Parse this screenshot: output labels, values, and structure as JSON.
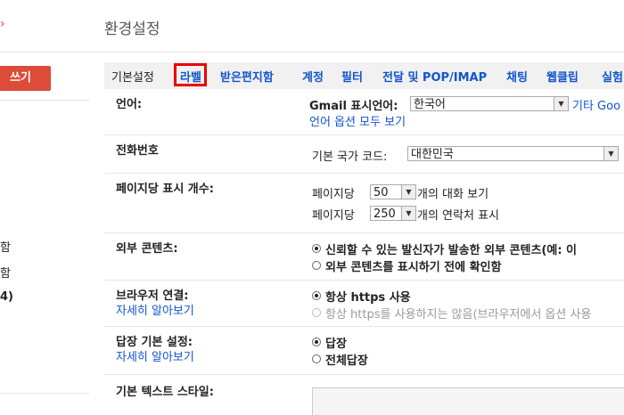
{
  "header": {
    "title": "환경설정"
  },
  "sidebar": {
    "compose_label": "쓰기",
    "items": [
      "함",
      "함",
      "4)"
    ]
  },
  "tabs": [
    {
      "label": "기본설정"
    },
    {
      "label": "라벨"
    },
    {
      "label": "받은편지함"
    },
    {
      "label": "계정"
    },
    {
      "label": "필터"
    },
    {
      "label": "전달 및 POP/IMAP"
    },
    {
      "label": "채팅"
    },
    {
      "label": "웹클립"
    },
    {
      "label": "실험"
    }
  ],
  "language": {
    "label": "언어:",
    "gmail_display_label": "Gmail 표시언어:",
    "selected": "한국어",
    "other_link": "기타 Goo",
    "all_options_link": "언어 옵션 모두 보기"
  },
  "phone": {
    "label": "전화번호",
    "country_label": "기본 국가 코드:",
    "selected": "대한민국"
  },
  "page_size": {
    "label": "페이지당 표시 개수:",
    "prefix": "페이지당",
    "conversations_value": "50",
    "conversations_suffix": "개의 대화 보기",
    "contacts_value": "250",
    "contacts_suffix": "개의 연락처 표시"
  },
  "external_content": {
    "label": "외부 콘텐츠:",
    "option1": "신뢰할 수 있는 발신자가 발송한 외부 콘텐츠(예: 이",
    "option2": "외부 콘텐츠를 표시하기 전에 확인함"
  },
  "browser_connection": {
    "label": "브라우저 연결:",
    "learn_more": "자세히 알아보기",
    "option1": "항상 https 사용",
    "option2": "항상 https를 사용하지는 않음(브라우저에서 옵션 사용"
  },
  "reply_default": {
    "label": "답장 기본 설정:",
    "learn_more": "자세히 알아보기",
    "option1": "답장",
    "option2": "전체답장"
  },
  "text_style": {
    "label": "기본 텍스트 스타일:"
  },
  "colors": {
    "accent_red": "#dd4b39",
    "link_blue": "#1155cc",
    "highlight_box": "#ee0000"
  }
}
